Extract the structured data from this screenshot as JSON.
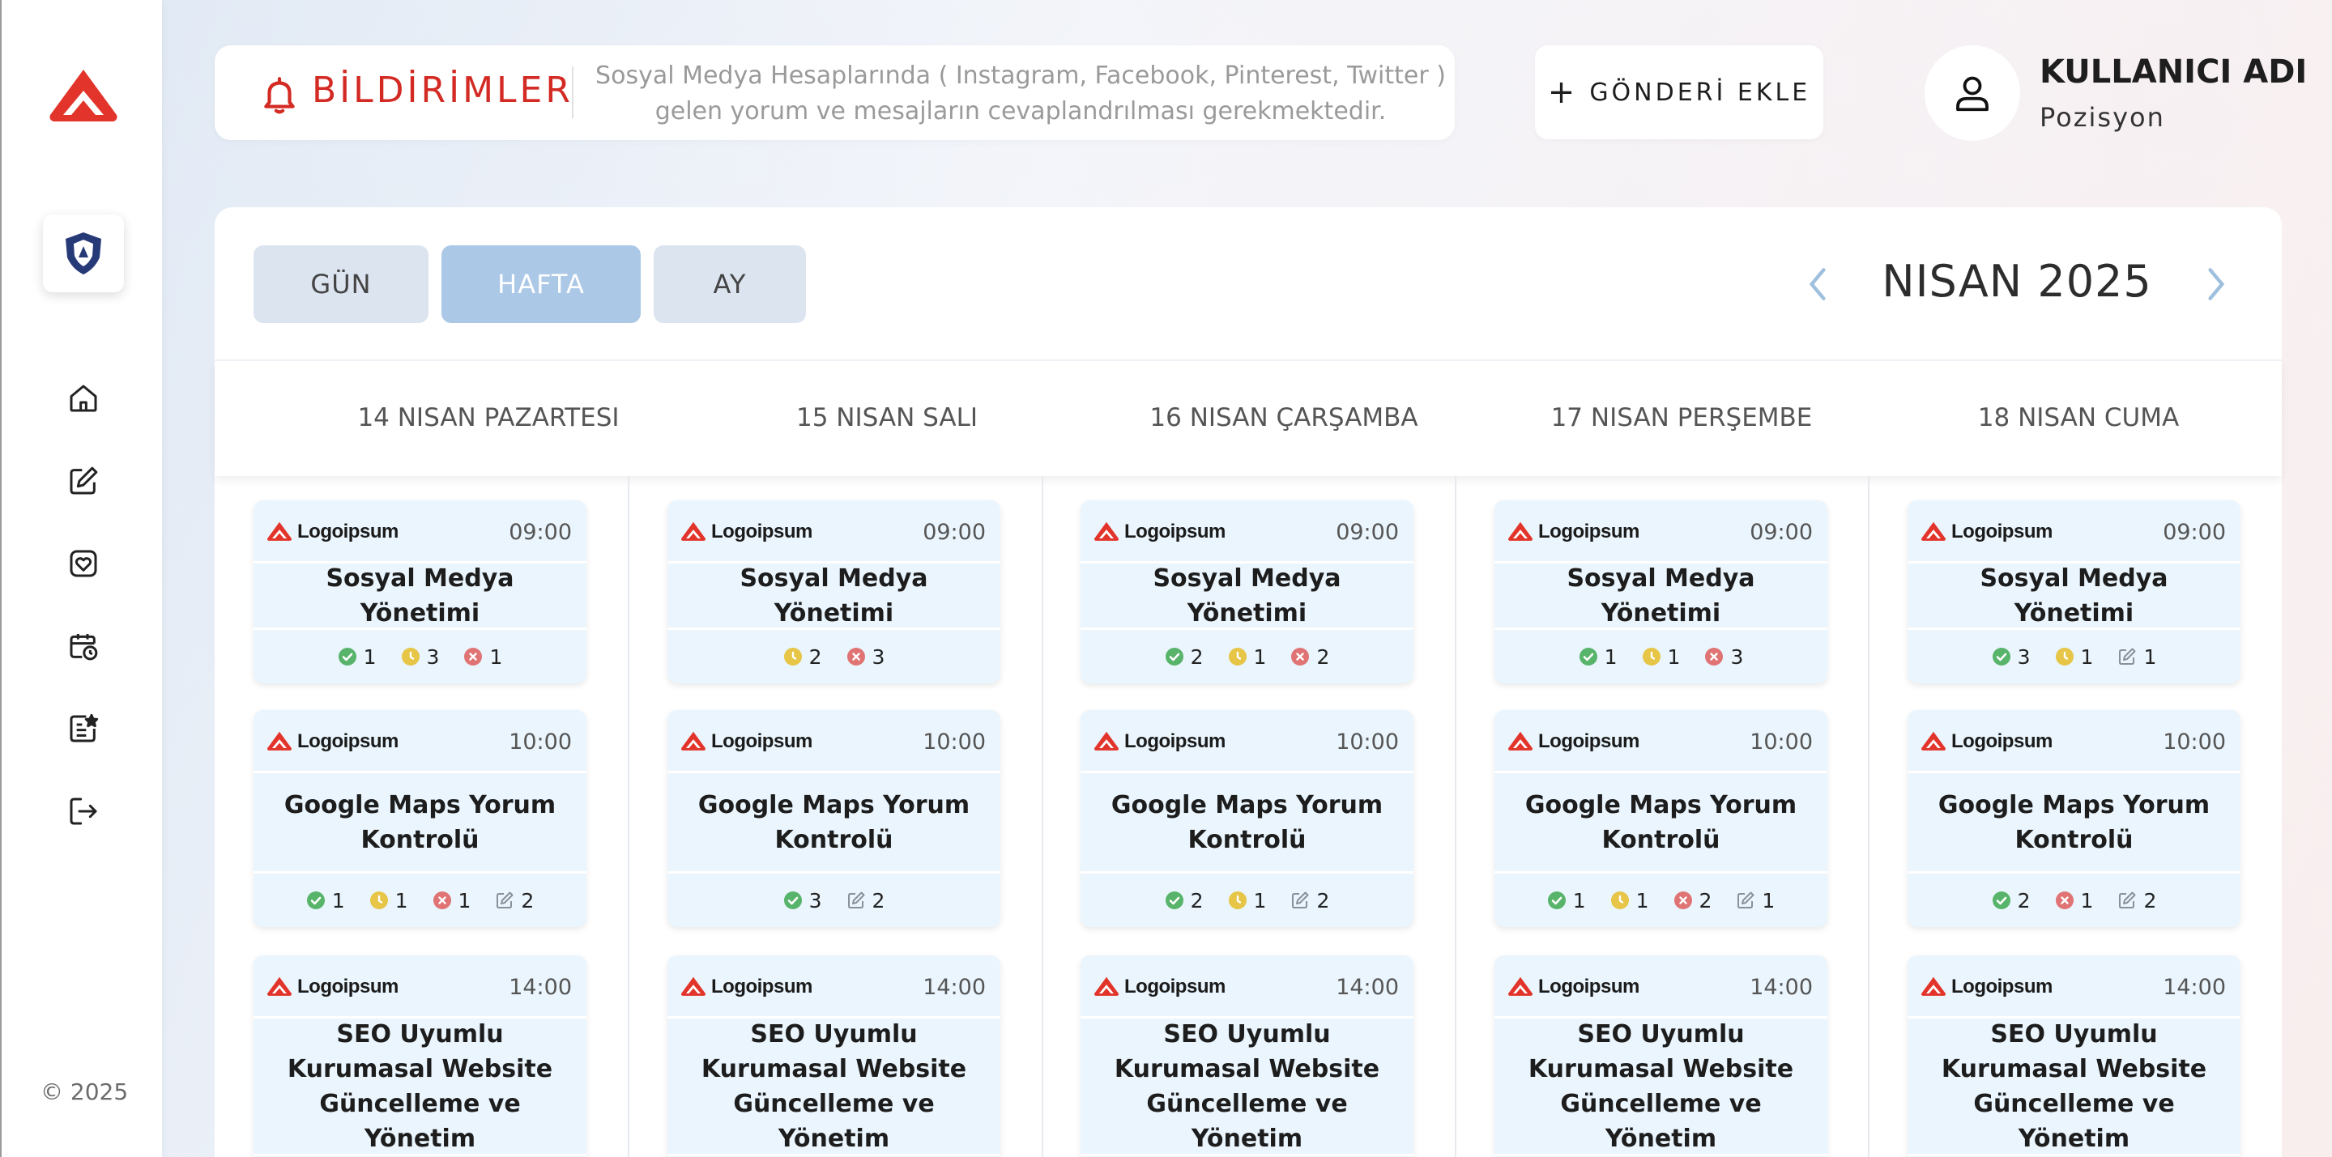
{
  "sidebar": {
    "copyright": "© 2025",
    "brand_color": "#e2342a",
    "nav": [
      {
        "name": "home-icon"
      },
      {
        "name": "edit-icon"
      },
      {
        "name": "heart-icon"
      },
      {
        "name": "calendar-clock-icon"
      },
      {
        "name": "list-star-icon"
      },
      {
        "name": "logout-icon"
      }
    ]
  },
  "header": {
    "notif_title": "BİLDİRİMLER",
    "notif_line1": "Sosyal Medya Hesaplarında ( Instagram, Facebook, Pinterest, Twitter )",
    "notif_line2": "gelen yorum ve mesajların cevaplandrılması gerekmektedir.",
    "add_post_label": "GÖNDERİ EKLE",
    "user_name": "KULLANICI ADI",
    "user_position": "Pozisyon"
  },
  "calendar": {
    "views": {
      "day": "GÜN",
      "week": "HAFTA",
      "month": "AY"
    },
    "active_view": "week",
    "month_title": "NISAN 2025",
    "days": [
      {
        "label": "14 NISAN PAZARTESI"
      },
      {
        "label": "15 NISAN SALI"
      },
      {
        "label": "16 NISAN ÇARŞAMBA"
      },
      {
        "label": "17 NISAN PERŞEMBE"
      },
      {
        "label": "18 NISAN CUMA"
      }
    ],
    "brand": "Logoipsum",
    "status_colors": {
      "done": "#58b46a",
      "pending": "#e6c547",
      "rejected": "#e07474",
      "edit": "#8a9099"
    },
    "rows": [
      {
        "time": "09:00",
        "title": "Sosyal Medya Yönetimi",
        "stats": [
          [
            {
              "type": "done",
              "count": "1"
            },
            {
              "type": "pending",
              "count": "3"
            },
            {
              "type": "rejected",
              "count": "1"
            }
          ],
          [
            {
              "type": "pending",
              "count": "2"
            },
            {
              "type": "rejected",
              "count": "3"
            }
          ],
          [
            {
              "type": "done",
              "count": "2"
            },
            {
              "type": "pending",
              "count": "1"
            },
            {
              "type": "rejected",
              "count": "2"
            }
          ],
          [
            {
              "type": "done",
              "count": "1"
            },
            {
              "type": "pending",
              "count": "1"
            },
            {
              "type": "rejected",
              "count": "3"
            }
          ],
          [
            {
              "type": "done",
              "count": "3"
            },
            {
              "type": "pending",
              "count": "1"
            },
            {
              "type": "edit",
              "count": "1"
            }
          ]
        ]
      },
      {
        "time": "10:00",
        "title": "Google Maps Yorum Kontrolü",
        "stats": [
          [
            {
              "type": "done",
              "count": "1"
            },
            {
              "type": "pending",
              "count": "1"
            },
            {
              "type": "rejected",
              "count": "1"
            },
            {
              "type": "edit",
              "count": "2"
            }
          ],
          [
            {
              "type": "done",
              "count": "3"
            },
            {
              "type": "edit",
              "count": "2"
            }
          ],
          [
            {
              "type": "done",
              "count": "2"
            },
            {
              "type": "pending",
              "count": "1"
            },
            {
              "type": "edit",
              "count": "2"
            }
          ],
          [
            {
              "type": "done",
              "count": "1"
            },
            {
              "type": "pending",
              "count": "1"
            },
            {
              "type": "rejected",
              "count": "2"
            },
            {
              "type": "edit",
              "count": "1"
            }
          ],
          [
            {
              "type": "done",
              "count": "2"
            },
            {
              "type": "rejected",
              "count": "1"
            },
            {
              "type": "edit",
              "count": "2"
            }
          ]
        ]
      },
      {
        "time": "14:00",
        "title": "SEO Uyumlu Kurumasal Website Güncelleme ve Yönetim",
        "stats": [
          [],
          [],
          [],
          [],
          []
        ]
      }
    ]
  }
}
